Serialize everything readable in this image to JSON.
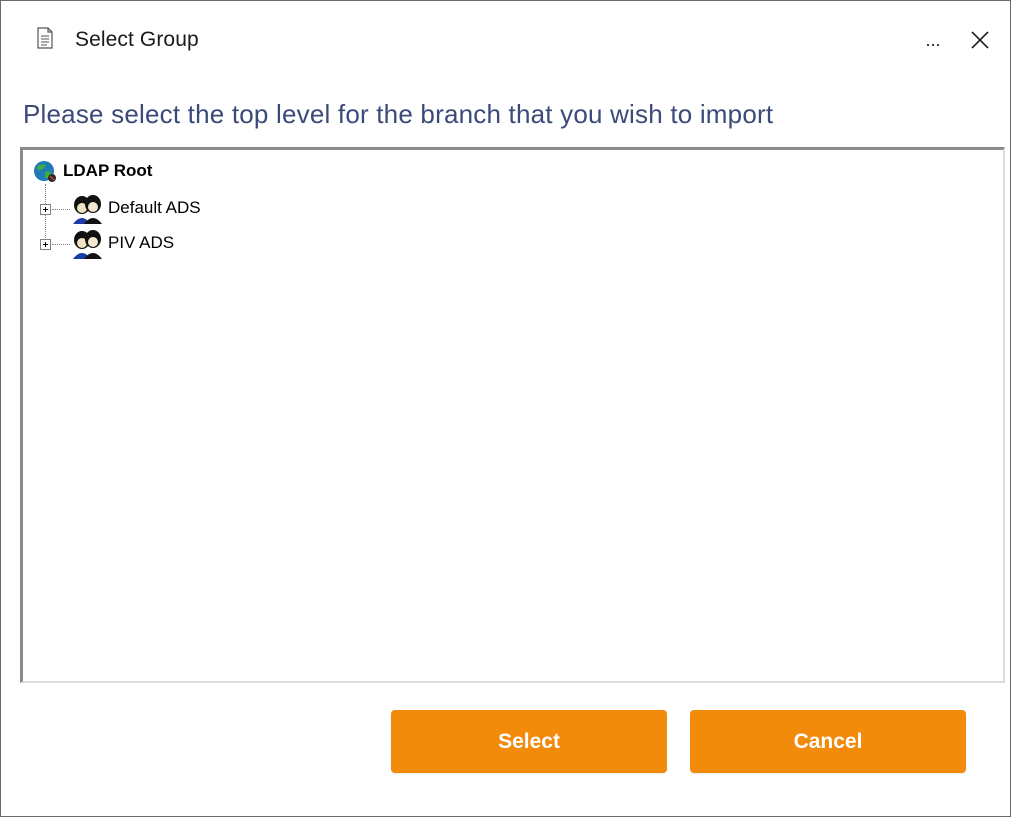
{
  "window": {
    "title": "Select Group",
    "more_label": "...",
    "close_icon": "close-icon"
  },
  "prompt": "Please select the top level for the branch that you wish to import",
  "tree": {
    "root": {
      "label": "LDAP Root",
      "icon": "ldap-root-globe-icon"
    },
    "children": [
      {
        "label": "Default ADS",
        "icon": "users-group-icon",
        "expanded": false
      },
      {
        "label": "PIV ADS",
        "icon": "users-group-icon",
        "expanded": false
      }
    ]
  },
  "buttons": {
    "select_label": "Select",
    "cancel_label": "Cancel"
  },
  "colors": {
    "accent": "#f28a0a",
    "prompt_text": "#3c4a7a"
  }
}
